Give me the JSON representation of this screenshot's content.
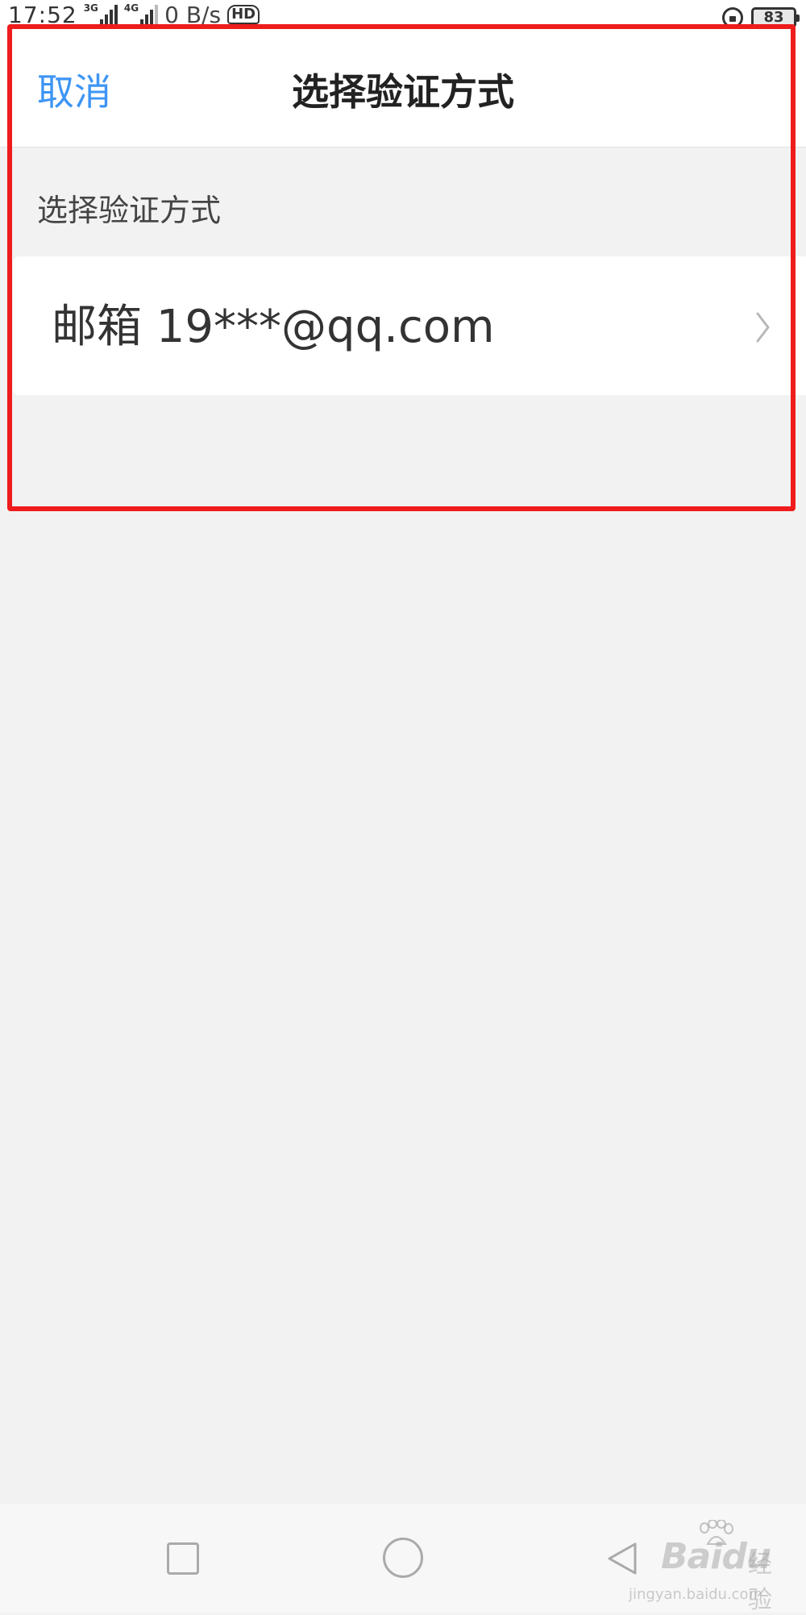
{
  "status_bar": {
    "time": "17:52",
    "network_1": "3G",
    "network_2": "4G",
    "speed": "0 B/s",
    "hd_label": "HD",
    "battery": "83"
  },
  "header": {
    "cancel_label": "取消",
    "title": "选择验证方式"
  },
  "section": {
    "label": "选择验证方式"
  },
  "options": [
    {
      "label": "邮箱 19***@qq.com"
    }
  ],
  "system_nav": {
    "icons": [
      "recent-apps-icon",
      "home-icon",
      "back-icon"
    ]
  },
  "watermark": {
    "brand": "Bai",
    "brand_du": "du",
    "jingyan": "经验",
    "url": "jingyan.baidu.com"
  },
  "colors": {
    "accent": "#3d95f4",
    "highlight": "#ee1c1c",
    "background": "#f2f2f2"
  }
}
